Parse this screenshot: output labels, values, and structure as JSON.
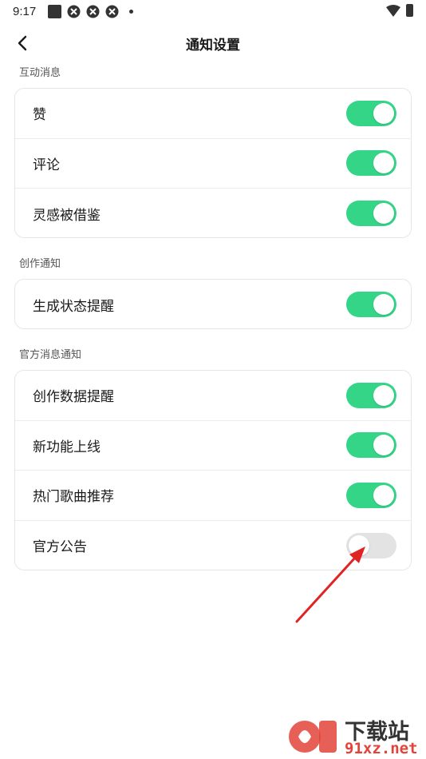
{
  "status_bar": {
    "time": "9:17"
  },
  "header": {
    "title": "通知设置"
  },
  "sections": [
    {
      "label": "互动消息",
      "items": [
        {
          "label": "赞",
          "enabled": true
        },
        {
          "label": "评论",
          "enabled": true
        },
        {
          "label": "灵感被借鉴",
          "enabled": true
        }
      ]
    },
    {
      "label": "创作通知",
      "items": [
        {
          "label": "生成状态提醒",
          "enabled": true
        }
      ]
    },
    {
      "label": "官方消息通知",
      "items": [
        {
          "label": "创作数据提醒",
          "enabled": true
        },
        {
          "label": "新功能上线",
          "enabled": true
        },
        {
          "label": "热门歌曲推荐",
          "enabled": true
        },
        {
          "label": "官方公告",
          "enabled": false
        }
      ]
    }
  ],
  "watermark": {
    "title": "下载站",
    "site": "91xz.net"
  },
  "colors": {
    "toggle_on": "#35d588",
    "toggle_off": "#e3e3e3",
    "annotation_arrow": "#e02424"
  }
}
